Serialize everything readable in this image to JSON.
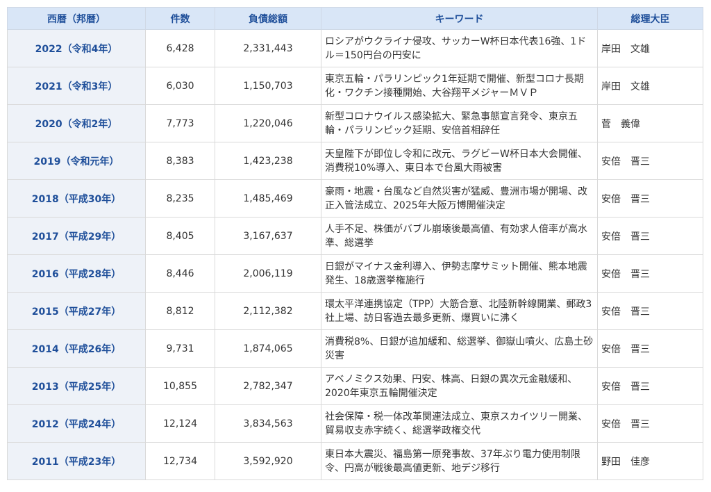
{
  "table": {
    "headers": [
      "西暦（邦暦）",
      "件数",
      "負債総額",
      "キーワード",
      "総理大臣"
    ],
    "rows": [
      {
        "year": "2022（令和4年）",
        "count": "6,428",
        "debt": "2,331,443",
        "keyword": "ロシアがウクライナ侵攻、サッカーW杯日本代表16強、1ドル＝150円台の円安に",
        "pm": "岸田　文雄"
      },
      {
        "year": "2021（令和3年）",
        "count": "6,030",
        "debt": "1,150,703",
        "keyword": "東京五輪・パラリンピック1年延期で開催、新型コロナ長期化・ワクチン接種開始、大谷翔平メジャーＭＶＰ",
        "pm": "岸田　文雄"
      },
      {
        "year": "2020（令和2年）",
        "count": "7,773",
        "debt": "1,220,046",
        "keyword": "新型コロナウイルス感染拡大、緊急事態宣言発令、東京五輪・パラリンピック延期、安倍首相辞任",
        "pm": "菅　義偉"
      },
      {
        "year": "2019（令和元年）",
        "count": "8,383",
        "debt": "1,423,238",
        "keyword": "天皇陛下が即位し令和に改元、ラグビーW杯日本大会開催、消費税10%導入、東日本で台風大雨被害",
        "pm": "安倍　晋三"
      },
      {
        "year": "2018（平成30年）",
        "count": "8,235",
        "debt": "1,485,469",
        "keyword": "豪雨・地震・台風など自然災害が猛威、豊洲市場が開場、改正入管法成立、2025年大阪万博開催決定",
        "pm": "安倍　晋三"
      },
      {
        "year": "2017（平成29年）",
        "count": "8,405",
        "debt": "3,167,637",
        "keyword": "人手不足、株価がバブル崩壊後最高値、有効求人倍率が高水準、総選挙",
        "pm": "安倍　晋三"
      },
      {
        "year": "2016（平成28年）",
        "count": "8,446",
        "debt": "2,006,119",
        "keyword": "日銀がマイナス金利導入、伊勢志摩サミット開催、熊本地震発生、18歳選挙権施行",
        "pm": "安倍　晋三"
      },
      {
        "year": "2015（平成27年）",
        "count": "8,812",
        "debt": "2,112,382",
        "keyword": "環太平洋連携協定（TPP）大筋合意、北陸新幹線開業、郵政3社上場、訪日客過去最多更新、爆買いに沸く",
        "pm": "安倍　晋三"
      },
      {
        "year": "2014（平成26年）",
        "count": "9,731",
        "debt": "1,874,065",
        "keyword": "消費税8%、日銀が追加緩和、総選挙、御嶽山噴火、広島土砂災害",
        "pm": "安倍　晋三"
      },
      {
        "year": "2013（平成25年）",
        "count": "10,855",
        "debt": "2,782,347",
        "keyword": "アベノミクス効果、円安、株高、日銀の異次元金融緩和、2020年東京五輪開催決定",
        "pm": "安倍　晋三"
      },
      {
        "year": "2012（平成24年）",
        "count": "12,124",
        "debt": "3,834,563",
        "keyword": "社会保障・税一体改革関連法成立、東京スカイツリー開業、貿易収支赤字続く、総選挙政権交代",
        "pm": "安倍　晋三"
      },
      {
        "year": "2011（平成23年）",
        "count": "12,734",
        "debt": "3,592,920",
        "keyword": "東日本大震災、福島第一原発事故、37年ぶり電力使用制限令、円高が戦後最高値更新、地デジ移行",
        "pm": "野田　佳彦"
      }
    ]
  }
}
